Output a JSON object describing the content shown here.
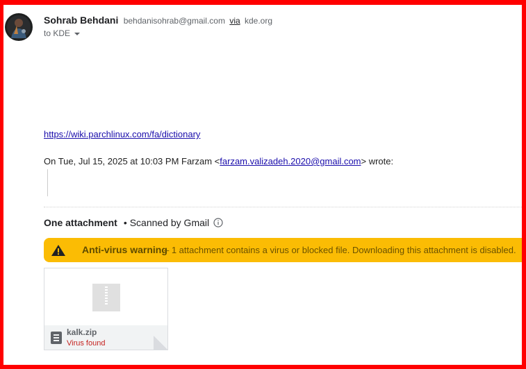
{
  "sender": {
    "name": "Sohrab Behdani",
    "email": "behdanisohrab@gmail.com",
    "via_label": "via",
    "via_domain": "kde.org",
    "recipients": "to KDE"
  },
  "message": {
    "link": "https://wiki.parchlinux.com/fa/dictionary",
    "quote_intro_prefix": "On Tue, Jul 15, 2025 at 10:03 PM Farzam <",
    "quote_intro_email": "farzam.valizadeh.2020@gmail.com",
    "quote_intro_suffix": "> wrote:"
  },
  "attachments": {
    "count_label": "One attachment",
    "dot": "•",
    "scanned_label": "Scanned by Gmail",
    "warning_title": "Anti-virus warning",
    "warning_text": "– 1 attachment contains a virus or blocked file. Downloading this attachment is disabled.",
    "file": {
      "name": "kalk.zip",
      "status": "Virus found"
    }
  },
  "colors": {
    "frame": "#ff0000",
    "warning_bg": "#fbbc04",
    "link": "#1a0dab",
    "virus_text": "#c5221f"
  },
  "icons": [
    "avatar",
    "chevron-down-icon",
    "info-icon",
    "warning-icon",
    "zip-file-icon",
    "document-icon"
  ]
}
